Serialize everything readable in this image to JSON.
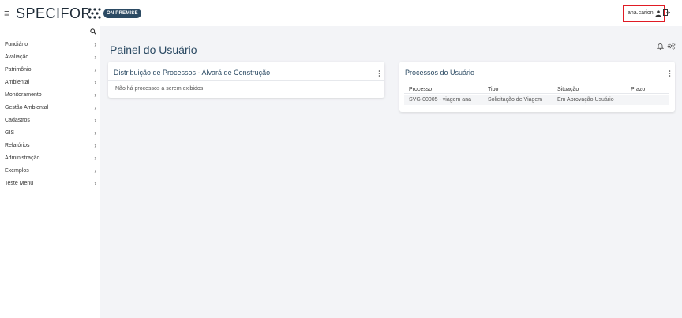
{
  "header": {
    "logo_text": "SPECIFOR",
    "badge": "ON PREMISE",
    "username": "ana.carioni"
  },
  "sidebar": {
    "items": [
      {
        "label": "Fundiário"
      },
      {
        "label": "Avaliação"
      },
      {
        "label": "Patrimônio"
      },
      {
        "label": "Ambiental"
      },
      {
        "label": "Monitoramento"
      },
      {
        "label": "Gestão Ambiental"
      },
      {
        "label": "Cadastros"
      },
      {
        "label": "GIS"
      },
      {
        "label": "Relatórios"
      },
      {
        "label": "Administração"
      },
      {
        "label": "Exemplos"
      },
      {
        "label": "Teste Menu"
      }
    ]
  },
  "main": {
    "title": "Painel do Usuário",
    "card_distribution": {
      "title": "Distribuição de Processos - Alvará de Construção",
      "empty_message": "Não há processos a serem exibidos"
    },
    "card_processes": {
      "title": "Processos do Usuário",
      "columns": [
        "Processo",
        "Tipo",
        "Situação",
        "Prazo"
      ],
      "rows": [
        [
          "SVG-00005 - viagem ana",
          "Solicitação de Viagem",
          "Em Aprovação Usuário",
          ""
        ]
      ]
    }
  },
  "colors": {
    "accent": "#2b4a63",
    "highlight_border": "#e01b24",
    "background": "#f3f4f7"
  },
  "icons": [
    "menu-icon",
    "search-icon",
    "user-icon",
    "logout-icon",
    "bell-icon",
    "gears-icon",
    "chevron-right-icon",
    "kebab-menu-icon"
  ]
}
